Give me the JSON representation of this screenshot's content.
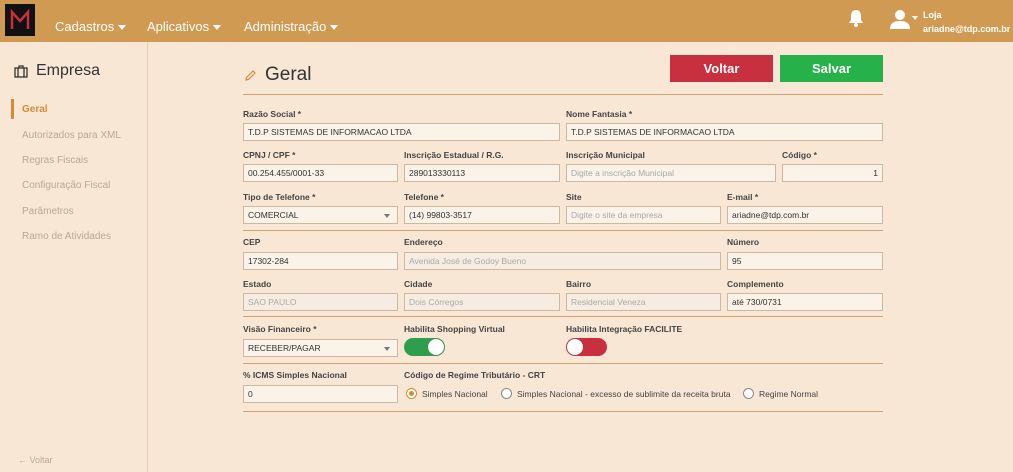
{
  "topbar": {
    "menu": [
      {
        "label": "Cadastros"
      },
      {
        "label": "Aplicativos"
      },
      {
        "label": "Administração"
      }
    ],
    "user": {
      "role": "Loja",
      "email": "ariadne@tdp.com.br"
    }
  },
  "sidebar": {
    "title": "Empresa",
    "items": [
      {
        "label": "Geral",
        "active": true
      },
      {
        "label": "Autorizados para XML"
      },
      {
        "label": "Regras Fiscais"
      },
      {
        "label": "Configuração Fiscal"
      },
      {
        "label": "Parâmetros"
      },
      {
        "label": "Ramo de Atividades"
      }
    ],
    "back": "← Voltar"
  },
  "main": {
    "title": "Geral",
    "buttons": {
      "back": "Voltar",
      "save": "Salvar"
    }
  },
  "form": {
    "razao_social": {
      "label": "Razão Social *",
      "value": "T.D.P SISTEMAS DE INFORMACAO LTDA"
    },
    "nome_fantasia": {
      "label": "Nome Fantasia *",
      "value": "T.D.P SISTEMAS DE INFORMACAO LTDA"
    },
    "cnpj": {
      "label": "CPNJ / CPF *",
      "value": "00.254.455/0001-33"
    },
    "inscricao_estadual": {
      "label": "Inscrição Estadual / R.G.",
      "value": "289013330113"
    },
    "inscricao_municipal": {
      "label": "Inscrição Municipal",
      "placeholder": "Digite a inscrição Municipal"
    },
    "codigo": {
      "label": "Código *",
      "value": "1"
    },
    "tipo_telefone": {
      "label": "Tipo de Telefone *",
      "value": "COMERCIAL"
    },
    "telefone": {
      "label": "Telefone *",
      "value": "(14) 99803-3517"
    },
    "site": {
      "label": "Site",
      "placeholder": "Digite o site da empresa"
    },
    "email": {
      "label": "E-mail *",
      "value": "ariadne@tdp.com.br"
    },
    "cep": {
      "label": "CEP",
      "value": "17302-284"
    },
    "endereco": {
      "label": "Endereço",
      "value": "Avenida José de Godoy Bueno"
    },
    "numero": {
      "label": "Número",
      "value": "95"
    },
    "estado": {
      "label": "Estado",
      "value": "SAO PAULO"
    },
    "cidade": {
      "label": "Cidade",
      "value": "Dois Córregos"
    },
    "bairro": {
      "label": "Bairro",
      "value": "Residencial Veneza"
    },
    "complemento": {
      "label": "Complemento",
      "value": "até 730/0731"
    },
    "visao_financeiro": {
      "label": "Visão Financeiro *",
      "value": "RECEBER/PAGAR"
    },
    "shopping_virtual": {
      "label": "Habilita Shopping Virtual",
      "enabled": true
    },
    "facilite": {
      "label": "Habilita Integração FACILITE",
      "enabled": false
    },
    "icms": {
      "label": "% ICMS Simples Nacional",
      "value": "0"
    },
    "crt": {
      "label": "Código de Regime Tributário - CRT",
      "options": [
        "Simples Nacional",
        "Simples Nacional - excesso de sublimite da receita bruta",
        "Regime Normal"
      ],
      "selected": "Simples Nacional"
    }
  },
  "colors": {
    "topbar": "#d19a52",
    "background": "#f7e7d4",
    "accent": "#d68a37",
    "danger": "#c8303f",
    "success": "#27b14a"
  }
}
